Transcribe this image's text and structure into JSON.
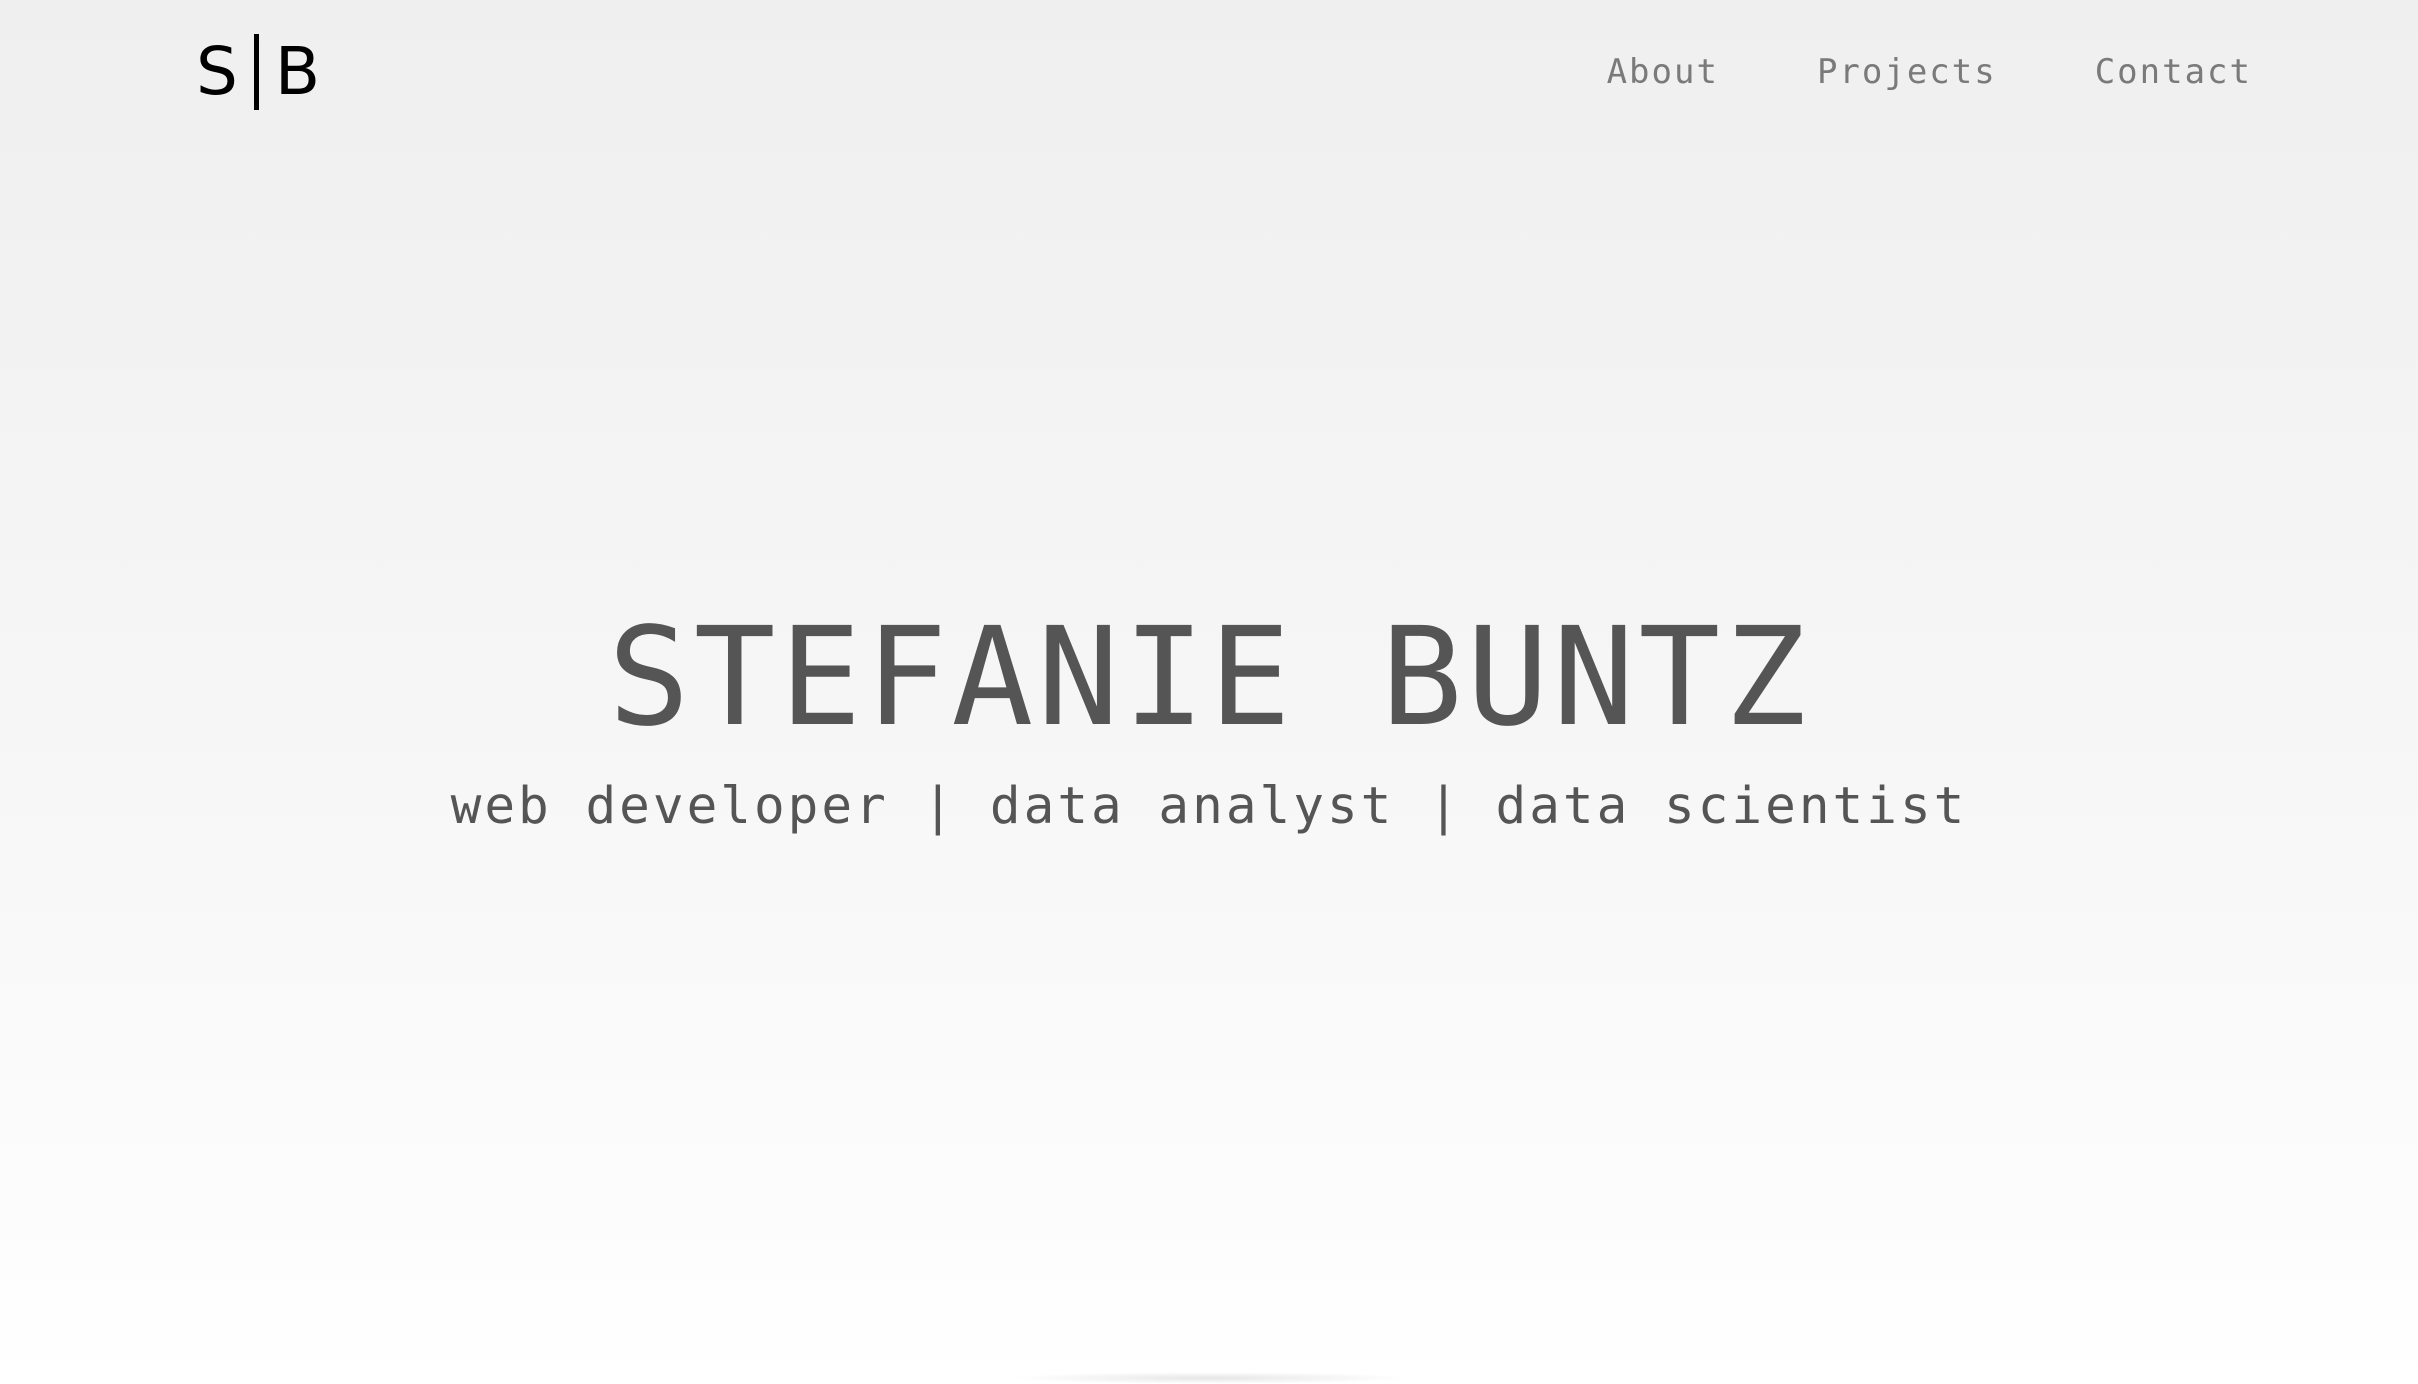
{
  "header": {
    "logo": {
      "left_letter": "S",
      "right_letter": "B"
    },
    "nav": [
      {
        "label": "About"
      },
      {
        "label": "Projects"
      },
      {
        "label": "Contact"
      }
    ]
  },
  "hero": {
    "name": "STEFANIE BUNTZ",
    "tagline": "web developer | data analyst | data scientist"
  },
  "colors": {
    "text": "#555555",
    "nav_text": "#7a7a7a",
    "logo": "#000000",
    "background": "#f3f3f3"
  }
}
